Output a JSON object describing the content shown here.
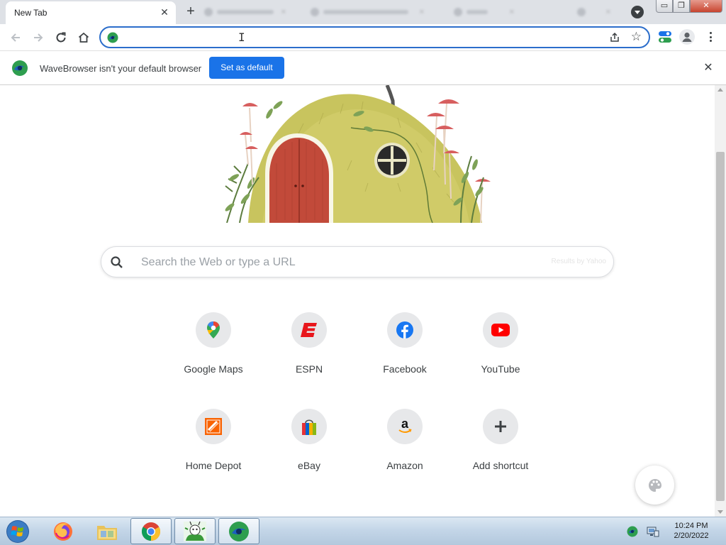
{
  "browser": {
    "active_tab": {
      "title": "New Tab",
      "close_glyph": "✕"
    },
    "new_tab_glyph": "+",
    "window_controls": {
      "minimize": "▭",
      "maximize": "❐",
      "close": "✕"
    },
    "toolbar": {
      "back_icon": "arrow-left-icon",
      "forward_icon": "arrow-right-icon",
      "reload_icon": "reload-icon",
      "home_icon": "home-icon",
      "address_value": "",
      "cursor_glyph": "I",
      "bookmark_glyph": "☆"
    }
  },
  "infobar": {
    "message": "WaveBrowser isn't your default browser",
    "button_label": "Set as default",
    "close_glyph": "✕"
  },
  "search": {
    "placeholder": "Search the Web or type a URL",
    "value": "",
    "provider_note": "Results by Yahoo"
  },
  "shortcuts": [
    {
      "label": "Google Maps",
      "icon": "google-maps-icon"
    },
    {
      "label": "ESPN",
      "icon": "espn-icon"
    },
    {
      "label": "Facebook",
      "icon": "facebook-icon"
    },
    {
      "label": "YouTube",
      "icon": "youtube-icon"
    },
    {
      "label": "Home Depot",
      "icon": "home-depot-icon"
    },
    {
      "label": "eBay",
      "icon": "ebay-icon"
    },
    {
      "label": "Amazon",
      "icon": "amazon-icon"
    },
    {
      "label": "Add shortcut",
      "icon": "plus-icon"
    }
  ],
  "taskbar": {
    "clock_time": "10:24 PM",
    "clock_date": "2/20/2022"
  },
  "colors": {
    "accent_blue": "#1a73e8",
    "omnibox_border": "#2c6ecb",
    "wave_green": "#2e9e4f",
    "wave_blue": "#1b5fbf"
  }
}
